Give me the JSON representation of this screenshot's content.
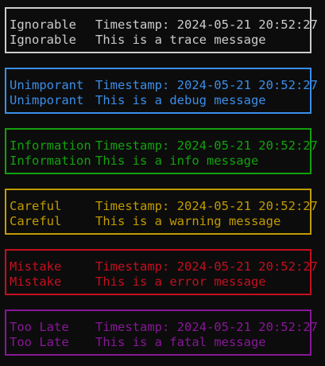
{
  "entries": [
    {
      "level": "Ignorable",
      "line1": "Timestamp: 2024-05-21 20:52:27",
      "line2": "This is a trace message",
      "color": "#cccccc"
    },
    {
      "level": "Unimporant",
      "line1": "Timestamp: 2024-05-21 20:52:27",
      "line2": "This is a debug message",
      "color": "#3b8eea"
    },
    {
      "level": "Information",
      "line1": "Timestamp: 2024-05-21 20:52:27",
      "line2": "This is a info message",
      "color": "#13a10e"
    },
    {
      "level": "Careful",
      "line1": "Timestamp: 2024-05-21 20:52:27",
      "line2": "This is a warning message",
      "color": "#c19c00"
    },
    {
      "level": "Mistake",
      "line1": "Timestamp: 2024-05-21 20:52:27",
      "line2": "This is a error message",
      "color": "#c50f1f"
    },
    {
      "level": "Too Late",
      "line1": "Timestamp: 2024-05-21 20:52:27",
      "line2": "This is a fatal message",
      "color": "#881798"
    }
  ]
}
